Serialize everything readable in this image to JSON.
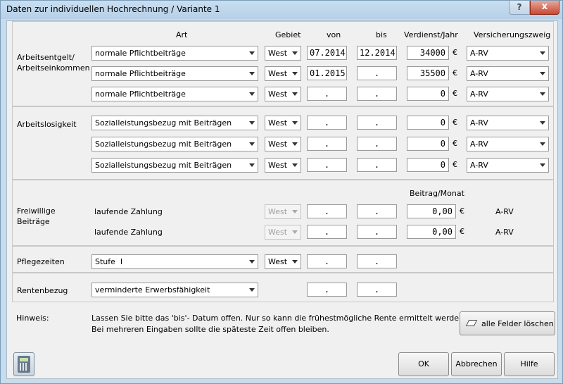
{
  "window": {
    "title": "Daten zur individuellen Hochrechnung / Variante 1",
    "help_label": "?",
    "close_label": "x"
  },
  "headers": {
    "art": "Art",
    "gebiet": "Gebiet",
    "von": "von",
    "bis": "bis",
    "verdienst": "Verdienst/Jahr",
    "zweig": "Versicherungszweig",
    "beitrag": "Beitrag/Monat"
  },
  "arbeitsentgelt": {
    "label_line1": "Arbeitsentgelt/",
    "label_line2": "Arbeitseinkommen",
    "rows": [
      {
        "art": "normale Pflichtbeiträge",
        "gebiet": "West",
        "von": "07.2014",
        "bis": "12.2014",
        "verdienst": "34000",
        "currency": "€",
        "zweig": "A-RV"
      },
      {
        "art": "normale Pflichtbeiträge",
        "gebiet": "West",
        "von": "01.2015",
        "bis": ".",
        "verdienst": "35500",
        "currency": "€",
        "zweig": "A-RV"
      },
      {
        "art": "normale Pflichtbeiträge",
        "gebiet": "West",
        "von": ".",
        "bis": ".",
        "verdienst": "0",
        "currency": "€",
        "zweig": "A-RV"
      }
    ]
  },
  "arbeitslosigkeit": {
    "label": "Arbeitslosigkeit",
    "rows": [
      {
        "art": "Sozialleistungsbezug mit Beiträgen",
        "gebiet": "West",
        "von": ".",
        "bis": ".",
        "verdienst": "0",
        "currency": "€",
        "zweig": "A-RV"
      },
      {
        "art": "Sozialleistungsbezug mit Beiträgen",
        "gebiet": "West",
        "von": ".",
        "bis": ".",
        "verdienst": "0",
        "currency": "€",
        "zweig": "A-RV"
      },
      {
        "art": "Sozialleistungsbezug mit Beiträgen",
        "gebiet": "West",
        "von": ".",
        "bis": ".",
        "verdienst": "0",
        "currency": "€",
        "zweig": "A-RV"
      }
    ]
  },
  "freiwillig": {
    "label_line1": "Freiwillige",
    "label_line2": "Beiträge",
    "rows": [
      {
        "art": "laufende Zahlung",
        "gebiet": "West",
        "von": ".",
        "bis": ".",
        "beitrag": "0,00",
        "currency": "€",
        "zweig": "A-RV"
      },
      {
        "art": "laufende Zahlung",
        "gebiet": "West",
        "von": ".",
        "bis": ".",
        "beitrag": "0,00",
        "currency": "€",
        "zweig": "A-RV"
      }
    ]
  },
  "pflege": {
    "label": "Pflegezeiten",
    "art": "Stufe  I",
    "gebiet": "West",
    "von": ".",
    "bis": "."
  },
  "rente": {
    "label": "Rentenbezug",
    "art": "verminderte Erwerbsfähigkeit",
    "von": ".",
    "bis": "."
  },
  "hinweis": {
    "label": "Hinweis:",
    "line1": "Lassen Sie bitte das 'bis'- Datum offen. Nur so kann die frühestmögliche Rente ermittelt werden.",
    "line2": "Bei mehreren Eingaben sollte die späteste Zeit offen bleiben."
  },
  "buttons": {
    "clear": "alle Felder löschen",
    "ok": "OK",
    "cancel": "Abbrechen",
    "help": "Hilfe"
  },
  "icons": {
    "calculator": "calculator-icon",
    "eraser": "eraser-icon"
  }
}
